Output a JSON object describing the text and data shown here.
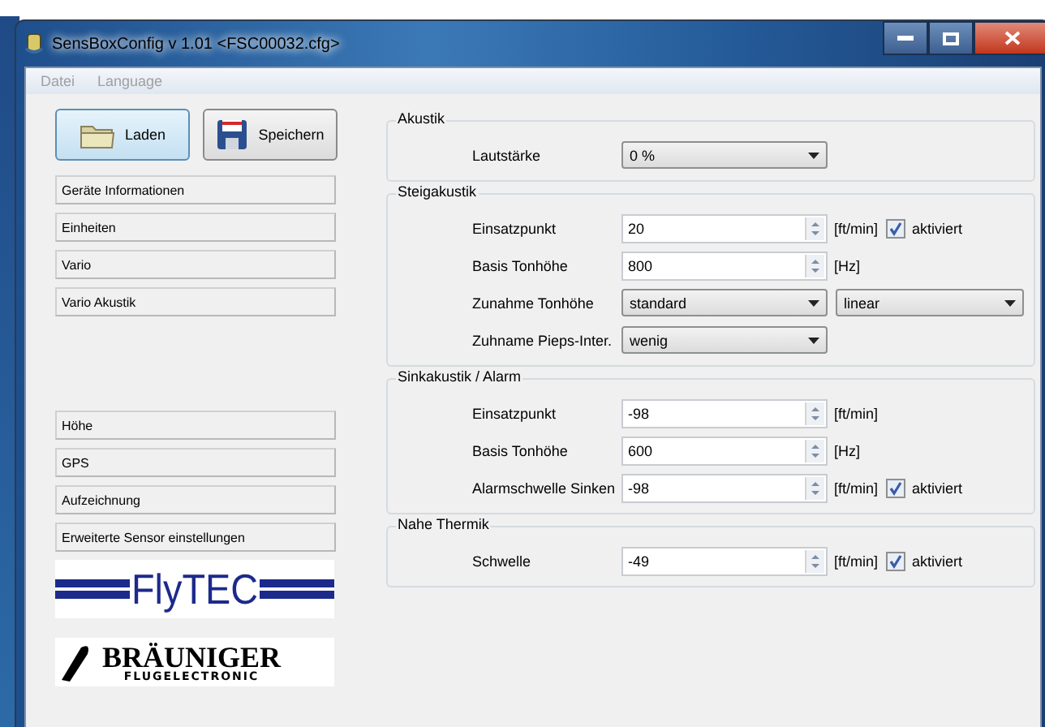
{
  "window": {
    "title": "SensBoxConfig v 1.01 <FSC00032.cfg>"
  },
  "menu": [
    {
      "label": "Datei",
      "disabled": true
    },
    {
      "label": "Language",
      "disabled": true
    }
  ],
  "toolbar": [
    {
      "label": "Laden",
      "kind": "folder",
      "selected": true
    },
    {
      "label": "Speichern",
      "kind": "disk",
      "selected": false
    }
  ],
  "sidebar": {
    "upper": [
      "Geräte Informationen",
      "Einheiten",
      "Vario",
      "Vario Akustik"
    ],
    "lower": [
      "Höhe",
      "GPS",
      "Aufzeichnung",
      "Erweiterte Sensor einstellungen"
    ]
  },
  "logos": [
    {
      "kind": "flytec",
      "text": "FlyTEC"
    },
    {
      "kind": "brauniger",
      "text": "BRÄUNIGER",
      "subtext": "FLUGELECTRONIC"
    }
  ],
  "groups": [
    {
      "title": "Akustik",
      "rows": [
        {
          "kind": "combo",
          "label": "Lautstärke",
          "selects": [
            "0 %"
          ]
        }
      ]
    },
    {
      "title": "Steigakustik",
      "rows": [
        {
          "kind": "spin",
          "label": "Einsatzpunkt",
          "value": "20",
          "unit": "[ft/min]",
          "checkbox": {
            "label": "aktiviert",
            "checked": true
          }
        },
        {
          "kind": "spin",
          "label": "Basis Tonhöhe",
          "value": "800",
          "unit": "[Hz]"
        },
        {
          "kind": "combo",
          "label": "Zunahme Tonhöhe",
          "selects": [
            "standard",
            "linear"
          ]
        },
        {
          "kind": "combo",
          "label": "Zuhname Pieps-Inter.",
          "selects": [
            "wenig"
          ]
        }
      ]
    },
    {
      "title": "Sinkakustik / Alarm",
      "rows": [
        {
          "kind": "spin",
          "label": "Einsatzpunkt",
          "value": "-98",
          "unit": "[ft/min]"
        },
        {
          "kind": "spin",
          "label": "Basis Tonhöhe",
          "value": "600",
          "unit": "[Hz]"
        },
        {
          "kind": "spin",
          "label": "Alarmschwelle Sinken",
          "value": "-98",
          "unit": "[ft/min]",
          "checkbox": {
            "label": "aktiviert",
            "checked": true
          }
        }
      ]
    },
    {
      "title": "Nahe Thermik",
      "rows": [
        {
          "kind": "spin",
          "label": "Schwelle",
          "value": "-49",
          "unit": "[ft/min]",
          "checkbox": {
            "label": "aktiviert",
            "checked": true
          }
        }
      ]
    }
  ]
}
